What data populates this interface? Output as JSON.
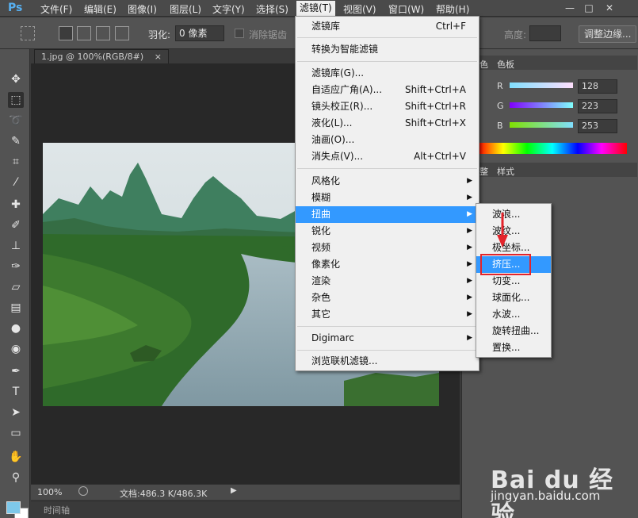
{
  "app": {
    "logo": "Ps"
  },
  "menubar": {
    "items": [
      "文件(F)",
      "编辑(E)",
      "图像(I)",
      "图层(L)",
      "文字(Y)",
      "选择(S)",
      "滤镜(T)",
      "视图(V)",
      "窗口(W)",
      "帮助(H)"
    ],
    "active": "滤镜(T)"
  },
  "window_controls": {
    "minimize": "—",
    "maximize": "□",
    "close": "✕"
  },
  "options_bar": {
    "feather_label": "羽化:",
    "feather_value": "0 像素",
    "antialias_label": "消除锯齿",
    "height_label": "高度:",
    "refine_edge_button": "调整边缘..."
  },
  "document": {
    "tab_title": "1.jpg @ 100%(RGB/8#)",
    "tab_close": "×",
    "zoom": "100%",
    "doc_info": "文档:486.3 K/486.3K"
  },
  "timeline": {
    "label": "时间轴"
  },
  "right_panel": {
    "tabs_top": [
      "色",
      "色板"
    ],
    "tabs_bottom": [
      "整",
      "样式"
    ],
    "channels": [
      {
        "name": "R",
        "value": "128"
      },
      {
        "name": "G",
        "value": "223"
      },
      {
        "name": "B",
        "value": "253"
      }
    ]
  },
  "filter_menu": {
    "items": [
      {
        "label": "滤镜库",
        "shortcut": "Ctrl+F"
      },
      {
        "label": "转换为智能滤镜"
      },
      {
        "label": "滤镜库(G)..."
      },
      {
        "label": "自适应广角(A)...",
        "shortcut": "Shift+Ctrl+A"
      },
      {
        "label": "镜头校正(R)...",
        "shortcut": "Shift+Ctrl+R"
      },
      {
        "label": "液化(L)...",
        "shortcut": "Shift+Ctrl+X"
      },
      {
        "label": "油画(O)..."
      },
      {
        "label": "消失点(V)...",
        "shortcut": "Alt+Ctrl+V"
      },
      {
        "label": "风格化"
      },
      {
        "label": "模糊"
      },
      {
        "label": "扭曲"
      },
      {
        "label": "锐化"
      },
      {
        "label": "视频"
      },
      {
        "label": "像素化"
      },
      {
        "label": "渲染"
      },
      {
        "label": "杂色"
      },
      {
        "label": "其它"
      },
      {
        "label": "Digimarc"
      },
      {
        "label": "浏览联机滤镜..."
      }
    ],
    "highlighted": "扭曲"
  },
  "distort_submenu": {
    "items": [
      "波浪...",
      "波纹...",
      "极坐标...",
      "挤压...",
      "切变...",
      "球面化...",
      "水波...",
      "旋转扭曲...",
      "置换..."
    ],
    "highlighted": "挤压..."
  },
  "watermark": {
    "brand": "Bai du 经验",
    "url": "jingyan.baidu.com"
  },
  "colors": {
    "highlight": "#3399ff",
    "callout": "#e3242b",
    "foreground_swatch": "#7ec8ea"
  }
}
